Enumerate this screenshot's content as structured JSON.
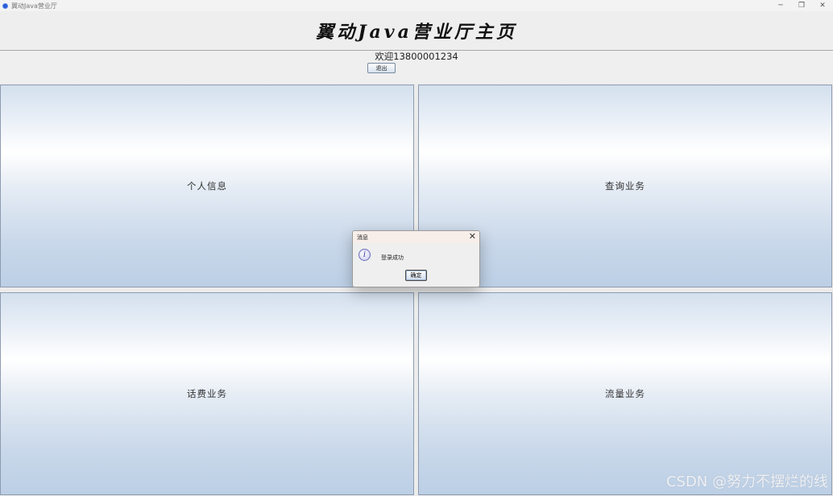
{
  "window": {
    "title": "翼动Java营业厅",
    "controls": {
      "minimize": "─",
      "restore": "❐",
      "close": "✕"
    }
  },
  "header": {
    "title": "翼动Java营业厅主页"
  },
  "welcome": {
    "text": "欢迎13800001234",
    "logout_label": "退出"
  },
  "panels": [
    {
      "label": "个人信息"
    },
    {
      "label": "查询业务"
    },
    {
      "label": "话费业务"
    },
    {
      "label": "流量业务"
    }
  ],
  "dialog": {
    "title": "消息",
    "message": "登录成功",
    "ok_label": "确定",
    "close_glyph": "✕",
    "icon_glyph": "i"
  },
  "watermark": "CSDN @努力不摆烂的线"
}
